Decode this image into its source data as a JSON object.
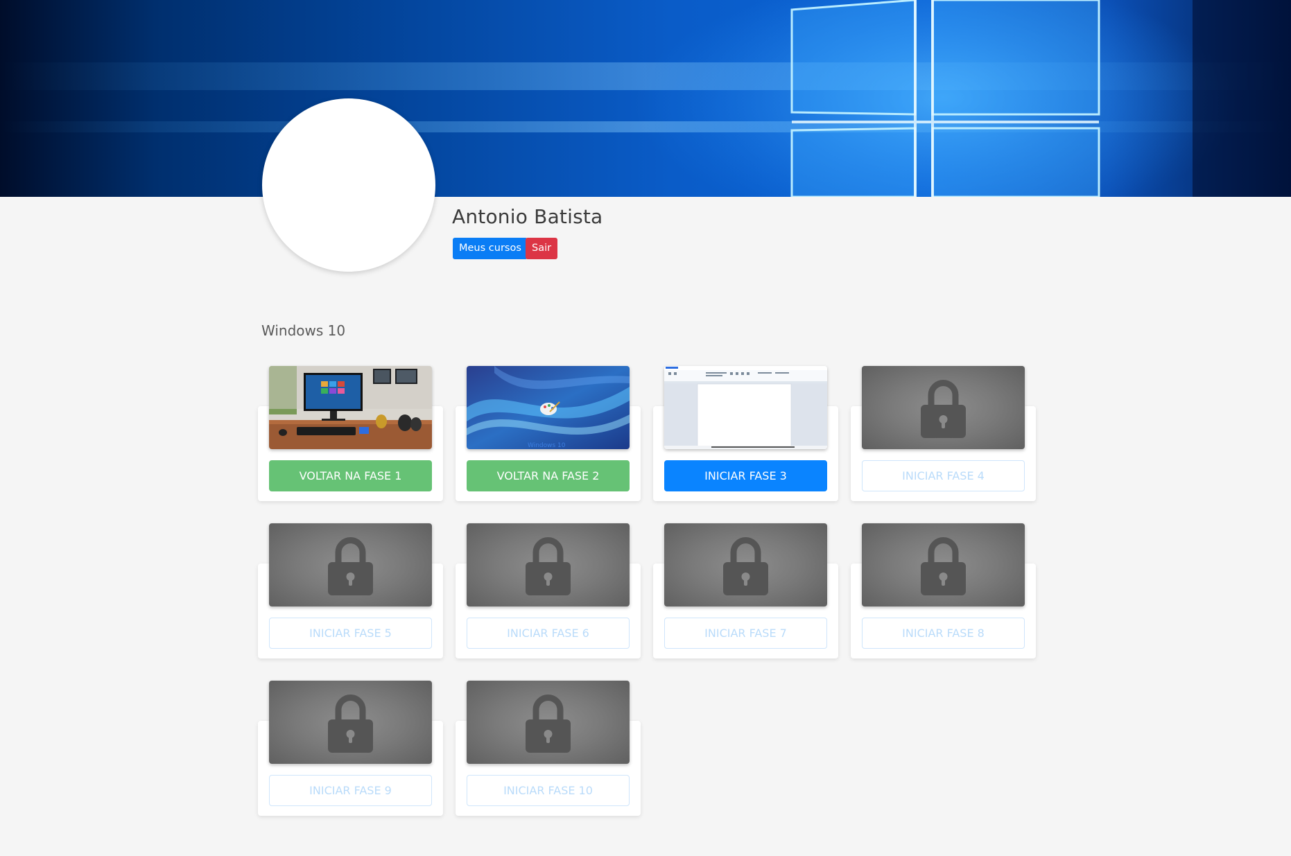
{
  "profile": {
    "name": "Antonio Batista",
    "buttons": {
      "my_courses": "Meus cursos",
      "logout": "Sair"
    }
  },
  "course": {
    "title": "Windows 10"
  },
  "colors": {
    "done": "#66c275",
    "active": "#0a84ff",
    "locked_text": "#b9dbfa",
    "logout": "#dc3545",
    "my_courses": "#0a7df5"
  },
  "phases": [
    {
      "label": "VOLTAR NA FASE 1",
      "status": "done",
      "thumb": "desktop-photo"
    },
    {
      "label": "VOLTAR NA FASE 2",
      "status": "done",
      "thumb": "windows10-wallpaper"
    },
    {
      "label": "INICIAR FASE 3",
      "status": "active",
      "thumb": "wordpad-screenshot"
    },
    {
      "label": "INICIAR FASE 4",
      "status": "locked",
      "thumb": "lock-icon"
    },
    {
      "label": "INICIAR FASE 5",
      "status": "locked",
      "thumb": "lock-icon"
    },
    {
      "label": "INICIAR FASE 6",
      "status": "locked",
      "thumb": "lock-icon"
    },
    {
      "label": "INICIAR FASE 7",
      "status": "locked",
      "thumb": "lock-icon"
    },
    {
      "label": "INICIAR FASE 8",
      "status": "locked",
      "thumb": "lock-icon"
    },
    {
      "label": "INICIAR FASE 9",
      "status": "locked",
      "thumb": "lock-icon"
    },
    {
      "label": "INICIAR FASE 10",
      "status": "locked",
      "thumb": "lock-icon"
    }
  ],
  "thumb_text": {
    "phase2_watermark": "Windows 10"
  }
}
